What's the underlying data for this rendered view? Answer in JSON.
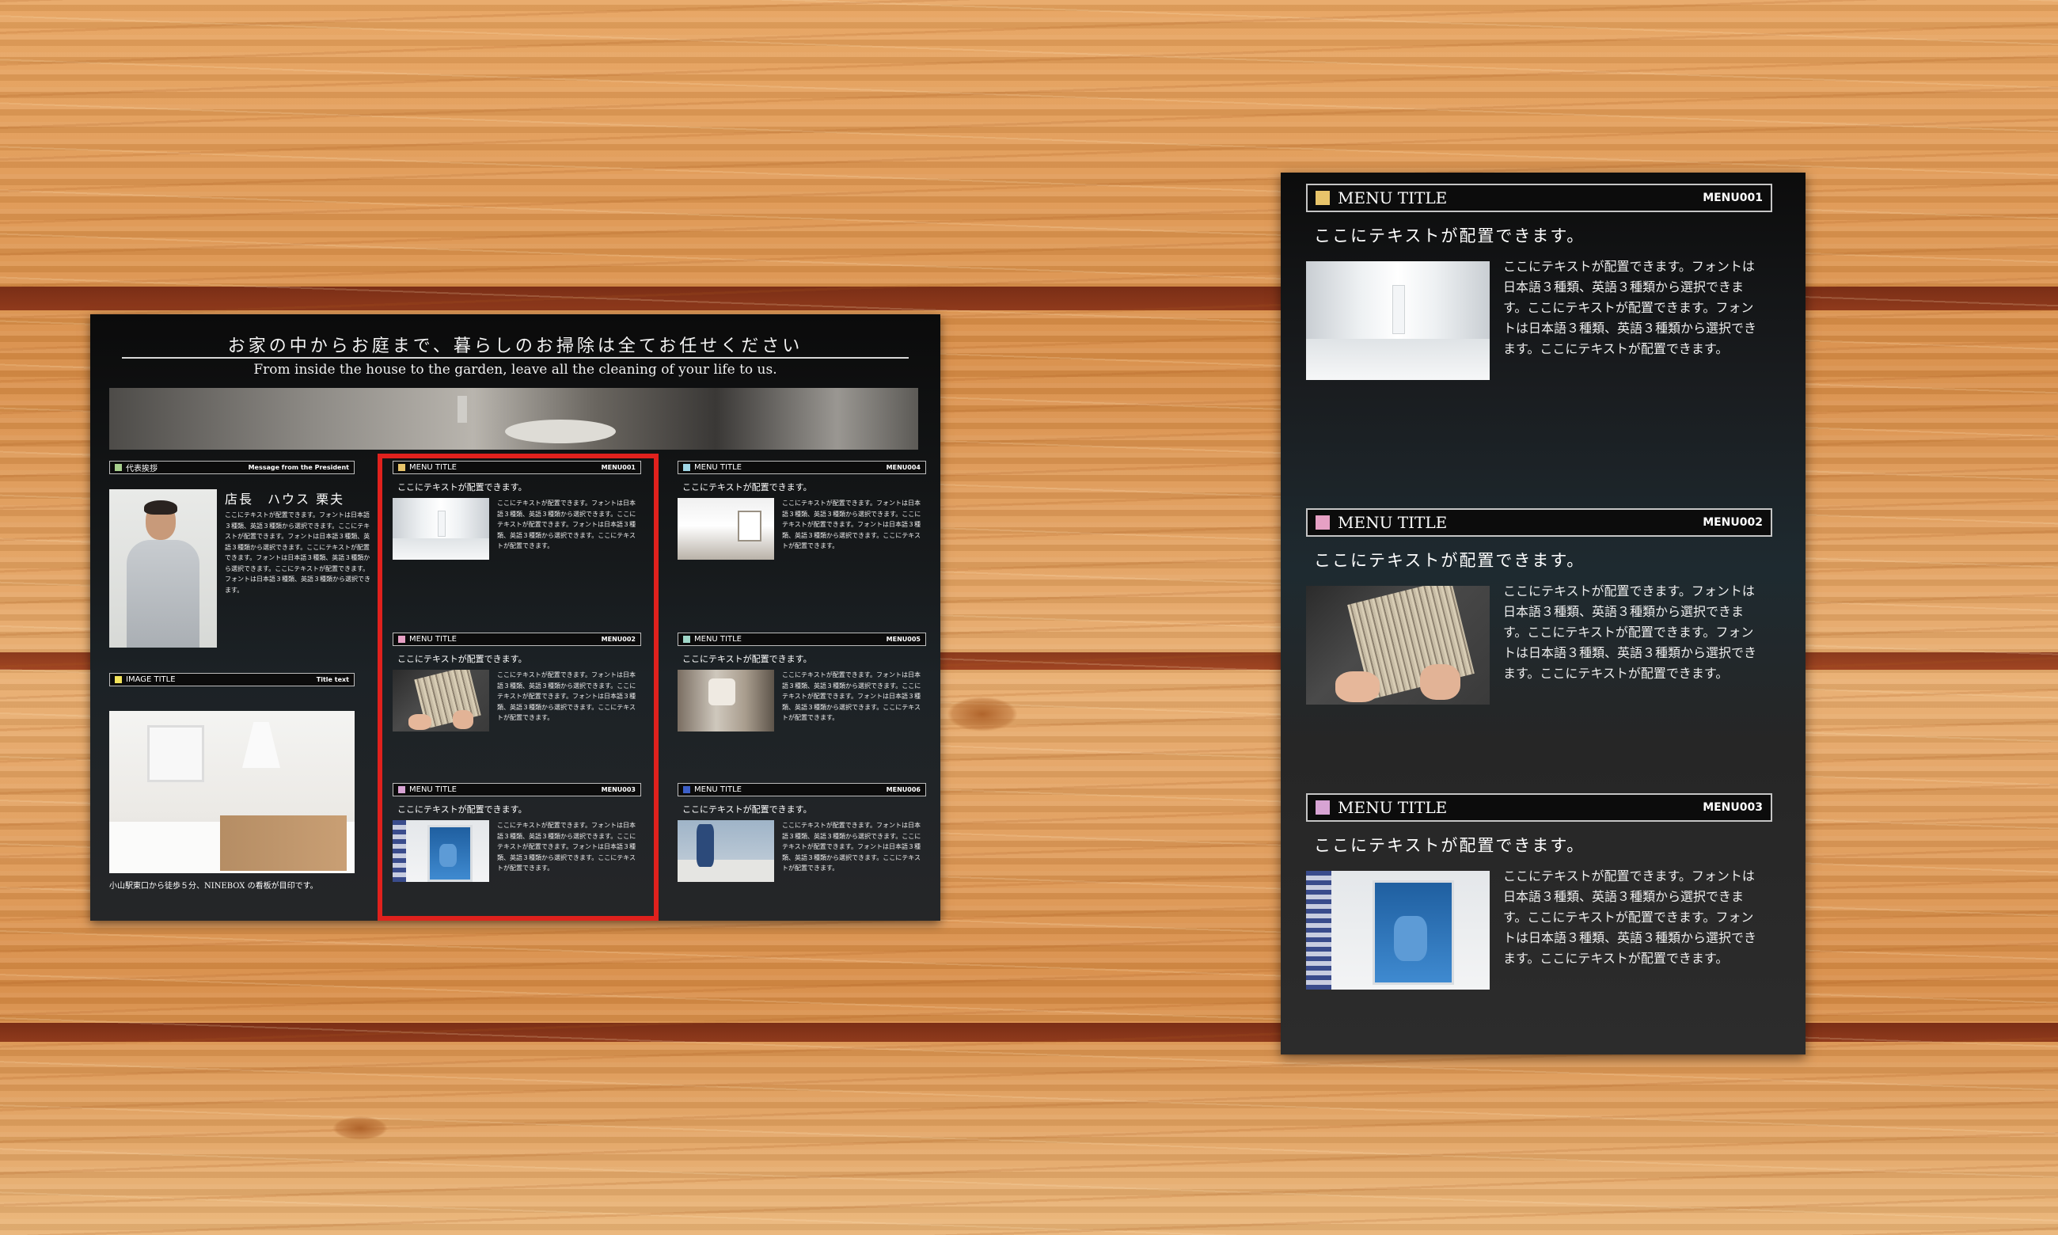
{
  "flyer": {
    "headline": "お家の中からお庭まで、暮らしのお掃除は全てお任せください",
    "subline": "From inside the house to the garden, leave all the cleaning of your life to us.",
    "president": {
      "bar_label": "代表挨拶",
      "bar_sub": "Message from the President",
      "name": "店長　ハウス 栗夫",
      "text": "ここにテキストが配置できます。フォントは日本語３種類、英語３種類から選択できます。ここにテキストが配置できます。フォントは日本語３種類、英語３種類から選択できます。ここにテキストが配置できます。フォントは日本語３種類、英語３種類から選択できます。ここにテキストが配置できます。フォントは日本語３種類、英語３種類から選択できます。"
    },
    "image_block": {
      "bar_label": "IMAGE TITLE",
      "bar_sub": "Title text",
      "caption": "小山駅東口から徒歩５分、NINEBOX の看板が目印です。"
    },
    "menus": [
      {
        "title": "MENU TITLE",
        "code": "MENU001",
        "color": "#e8c46a",
        "intro": "ここにテキストが配置できます。",
        "body": "ここにテキストが配置できます。フォントは日本語３種類、英語３種類から選択できます。ここにテキストが配置できます。フォントは日本語３種類、英語３種類から選択できます。ここにテキストが配置できます。",
        "image": "hallway-image"
      },
      {
        "title": "MENU TITLE",
        "code": "MENU002",
        "color": "#e6a0c4",
        "intro": "ここにテキストが配置できます。",
        "body": "ここにテキストが配置できます。フォントは日本語３種類、英語３種類から選択できます。ここにテキストが配置できます。フォントは日本語３種類、英語３種類から選択できます。ここにテキストが配置できます。",
        "image": "filter-cleaning-image"
      },
      {
        "title": "MENU TITLE",
        "code": "MENU003",
        "color": "#d7a3d3",
        "intro": "ここにテキストが配置できます。",
        "body": "ここにテキストが配置できます。フォントは日本語３種類、英語３種類から選択できます。ここにテキストが配置できます。フォントは日本語３種類、英語３種類から選択できます。ここにテキストが配置できます。",
        "image": "window-cleaning-image"
      },
      {
        "title": "MENU TITLE",
        "code": "MENU004",
        "color": "#9fd6e6",
        "intro": "ここにテキストが配置できます。",
        "body": "ここにテキストが配置できます。フォントは日本語３種類、英語３種類から選択できます。ここにテキストが配置できます。フォントは日本語３種類、英語３種類から選択できます。ここにテキストが配置できます。",
        "image": "lobby-image"
      },
      {
        "title": "MENU TITLE",
        "code": "MENU005",
        "color": "#9fd6c8",
        "intro": "ここにテキストが配置できます。",
        "body": "ここにテキストが配置できます。フォントは日本語３種類、英語３種類から選択できます。ここにテキストが配置できます。フォントは日本語３種類、英語３種類から選択できます。ここにテキストが配置できます。",
        "image": "bathroom-image"
      },
      {
        "title": "MENU TITLE",
        "code": "MENU006",
        "color": "#3c5fc8",
        "intro": "ここにテキストが配置できます。",
        "body": "ここにテキストが配置できます。フォントは日本語３種類、英語３種類から選択できます。ここにテキストが配置できます。フォントは日本語３種類、英語３種類から選択できます。ここにテキストが配置できます。",
        "image": "building-worker-image"
      }
    ],
    "president_square_color": "#a8d08d",
    "image_square_color": "#f2e35a"
  },
  "panel": {
    "menus": [
      {
        "title": "MENU TITLE",
        "code": "MENU001",
        "color": "#e8c46a",
        "intro": "ここにテキストが配置できます。",
        "body": "ここにテキストが配置できます。フォントは日本語３種類、英語３種類から選択できます。ここにテキストが配置できます。フォントは日本語３種類、英語３種類から選択できます。ここにテキストが配置できます。",
        "image": "hallway-image"
      },
      {
        "title": "MENU TITLE",
        "code": "MENU002",
        "color": "#e6a0c4",
        "intro": "ここにテキストが配置できます。",
        "body": "ここにテキストが配置できます。フォントは日本語３種類、英語３種類から選択できます。ここにテキストが配置できます。フォントは日本語３種類、英語３種類から選択できます。ここにテキストが配置できます。",
        "image": "filter-cleaning-image"
      },
      {
        "title": "MENU TITLE",
        "code": "MENU003",
        "color": "#d7a3d3",
        "intro": "ここにテキストが配置できます。",
        "body": "ここにテキストが配置できます。フォントは日本語３種類、英語３種類から選択できます。ここにテキストが配置できます。フォントは日本語３種類、英語３種類から選択できます。ここにテキストが配置できます。",
        "image": "window-cleaning-image"
      }
    ]
  },
  "highlight_color": "#e0211d"
}
